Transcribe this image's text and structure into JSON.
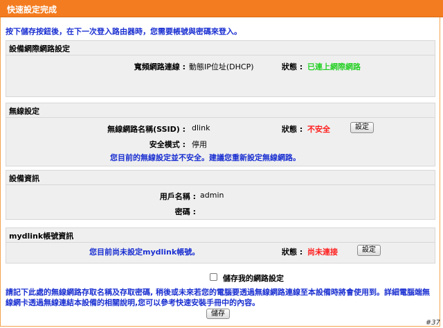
{
  "header": {
    "title": "快速設定完成"
  },
  "intro": "按下儲存按鈕後，在下一次登入路由器時，您需要帳號與密碼來登入。",
  "network": {
    "title": "設備網際網路設定",
    "conn_label": "寬頻網路連線 :",
    "conn_value": "動態IP位址(DHCP)",
    "status_label": "狀態 :",
    "status_value": "已連上網際網路"
  },
  "wireless": {
    "title": "無線設定",
    "ssid_label": "無線網路名稱(SSID) :",
    "ssid_value": "dlink",
    "status_label": "狀態 :",
    "status_value": "不安全",
    "setup_button": "設定",
    "security_label": "安全模式 :",
    "security_value": "停用",
    "warning": "您目前的無線設定並不安全。建議您重新設定無線網路。"
  },
  "device": {
    "title": "設備資訊",
    "user_label": "用戶名稱 :",
    "user_value": "admin",
    "password_label": "密碼 :"
  },
  "mydlink": {
    "title": "mydlink帳號資訊",
    "message": "您目前尚未設定mydlink帳號。",
    "status_label": "狀態 :",
    "status_value": "尚未連接",
    "setup_button": "設定"
  },
  "save_checkbox_label": "儲存我的網路設定",
  "note": "請記下此處的無線網路存取名稱及存取密碼, 稍後或未來若您的電腦要透過無線網路連線至本設備時將會使用到。詳細電腦端無線網卡透過無線連結本設備的相關說明,您可以參考快速安裝手冊中的內容。",
  "save_button": "儲存",
  "watermark": "#37"
}
